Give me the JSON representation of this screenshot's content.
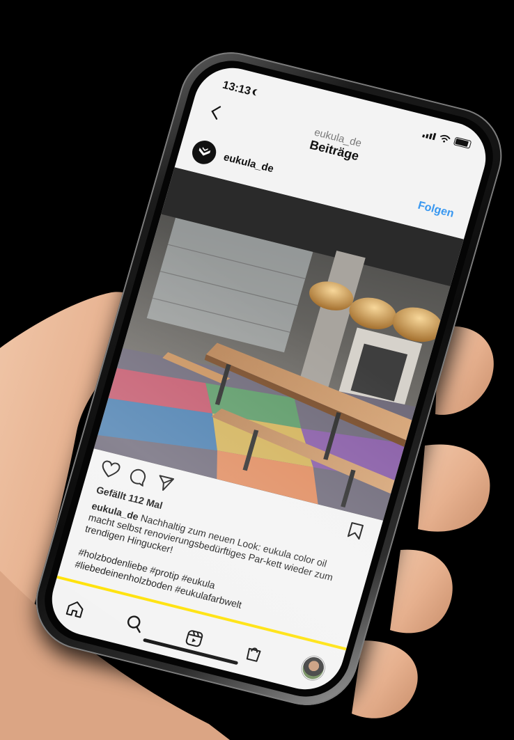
{
  "status_bar": {
    "time": "13:13"
  },
  "header": {
    "subtitle": "eukula_de",
    "title": "Beiträge"
  },
  "post": {
    "username": "eukula_de",
    "follow_label": "Folgen",
    "more_label": "...",
    "likes_text": "Gefällt 112 Mal",
    "caption_user": "eukula_de",
    "caption_text": "Nachhaltig zum neuen Look: eukula color oil macht selbst renovierungsbedürftiges Par-kett wieder zum trendigen Hingucker!",
    "hashtags_line1": "#holzbodenliebe #protip #eukula",
    "hashtags_line2": "#liebedeinenholzboden #eukulafarbwelt"
  },
  "colors": {
    "accent_blue": "#3897f0",
    "yellow_stripe": "#ffe100"
  },
  "icons": {
    "back": "back-chevron-icon",
    "like": "heart-icon",
    "comment": "comment-icon",
    "share": "paper-plane-icon",
    "save": "bookmark-icon",
    "nav": [
      "home-icon",
      "search-icon",
      "reels-icon",
      "shop-icon",
      "profile-avatar"
    ]
  }
}
